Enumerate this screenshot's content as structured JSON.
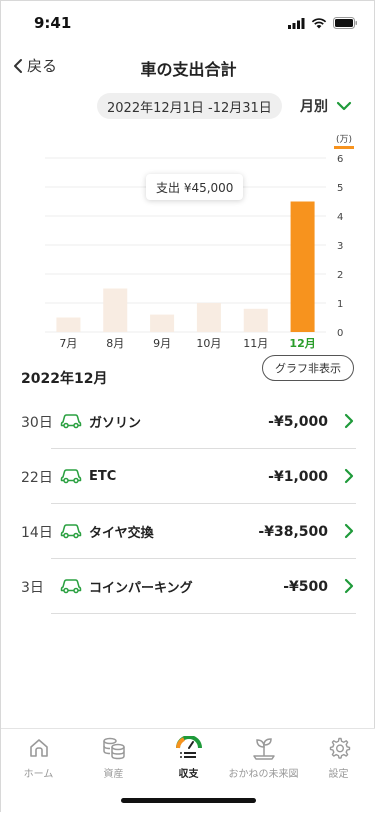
{
  "status": {
    "time": "9:41"
  },
  "header": {
    "back_label": "戻る",
    "title": "車の支出合計"
  },
  "period": {
    "range": "2022年12月1日 -12月31日",
    "mode": "月別"
  },
  "chart_data": {
    "type": "bar",
    "categories": [
      "7月",
      "8月",
      "9月",
      "10月",
      "11月",
      "12月"
    ],
    "values": [
      0.5,
      1.5,
      0.6,
      1.0,
      0.8,
      4.5
    ],
    "ylim": [
      0,
      6
    ],
    "yticks": [
      "0",
      "1",
      "2",
      "3",
      "4",
      "5",
      "6"
    ],
    "yunit": "(万)",
    "highlight_index": 5,
    "tooltip": "支出 ¥45,000",
    "bar_color": "#f8ece2",
    "highlight_color": "#f7931e",
    "highlight_label_color": "#2a9d2a"
  },
  "section": {
    "title": "2022年12月",
    "toggle_label": "グラフ非表示"
  },
  "transactions": [
    {
      "day": "30日",
      "name": "ガソリン",
      "amount": "-¥5,000"
    },
    {
      "day": "22日",
      "name": "ETC",
      "amount": "-¥1,000"
    },
    {
      "day": "14日",
      "name": "タイヤ交換",
      "amount": "-¥38,500"
    },
    {
      "day": "3日",
      "name": "コインパーキング",
      "amount": "-¥500"
    }
  ],
  "tabs": [
    {
      "label": "ホーム",
      "icon": "home-icon"
    },
    {
      "label": "資産",
      "icon": "coins-icon"
    },
    {
      "label": "収支",
      "icon": "balance-icon"
    },
    {
      "label": "おかねの未来図",
      "icon": "sprout-icon"
    },
    {
      "label": "設定",
      "icon": "gear-icon"
    }
  ],
  "active_tab": 2,
  "colors": {
    "accent_green": "#1f9a3a",
    "accent_orange": "#f7931e"
  }
}
